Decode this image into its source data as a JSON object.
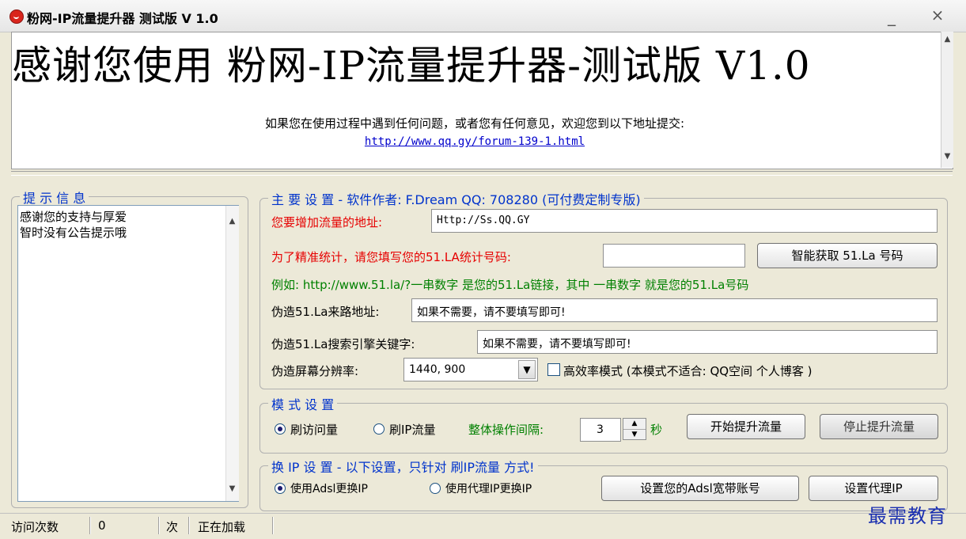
{
  "window": {
    "title": "粉网-IP流量提升器 测试版 V 1.0",
    "minimize_glyph": "_",
    "close_glyph": "×"
  },
  "banner": {
    "heading": "感谢您使用 粉网-IP流量提升器-测试版 V1.0",
    "notice": "如果您在使用过程中遇到任何问题，或者您有任何意见，欢迎您到以下地址提交:",
    "link": "http://www.qq.gy/forum-139-1.html"
  },
  "hint_panel": {
    "legend": "提 示 信 息",
    "lines": [
      "感谢您的支持与厚爱",
      "智时没有公告提示哦"
    ]
  },
  "main_settings": {
    "legend": "主 要 设 置 - 软件作者: F.Dream QQ: 708280 (可付费定制专版)",
    "url_label": "您要增加流量的地址:",
    "url_value": "Http://Ss.QQ.GY",
    "stat_label": "为了精准统计，请您填写您的51.LA统计号码:",
    "stat_value": "",
    "fetch_button": "智能获取 51.La 号码",
    "example": "例如: http://www.51.la/?一串数字 是您的51.La链接，其中 一串数字 就是您的51.La号码",
    "referer_label": "伪造51.La来路地址:",
    "referer_value": "如果不需要，请不要填写即可!",
    "keyword_label": "伪造51.La搜索引擎关键字:",
    "keyword_value": "如果不需要，请不要填写即可!",
    "resolution_label": "伪造屏幕分辨率:",
    "resolution_value": "1440, 900",
    "efficient_mode_label": "高效率模式 (本模式不适合: QQ空间 个人博客 )"
  },
  "mode_settings": {
    "legend": "模 式 设 置",
    "option_visits": "刷访问量",
    "option_ip": "刷IP流量",
    "interval_label": "整体操作间隔:",
    "interval_value": "3",
    "interval_unit": "秒",
    "start_button": "开始提升流量",
    "stop_button": "停止提升流量"
  },
  "ip_settings": {
    "legend": "换 IP 设 置 - 以下设置，只针对 刷IP流量 方式!",
    "option_adsl": "使用Adsl更换IP",
    "option_proxy": "使用代理IP更换IP",
    "adsl_button": "设置您的Adsl宽带账号",
    "proxy_button": "设置代理IP"
  },
  "status_bar": {
    "visits_label": "访问次数",
    "visits_value": "0",
    "unit": "次",
    "status": "正在加载"
  },
  "watermark": "最需教育",
  "colors": {
    "legend_blue": "#0033cc",
    "red_label": "#e60000",
    "green_text": "#008000",
    "link_blue": "#0000cc"
  }
}
